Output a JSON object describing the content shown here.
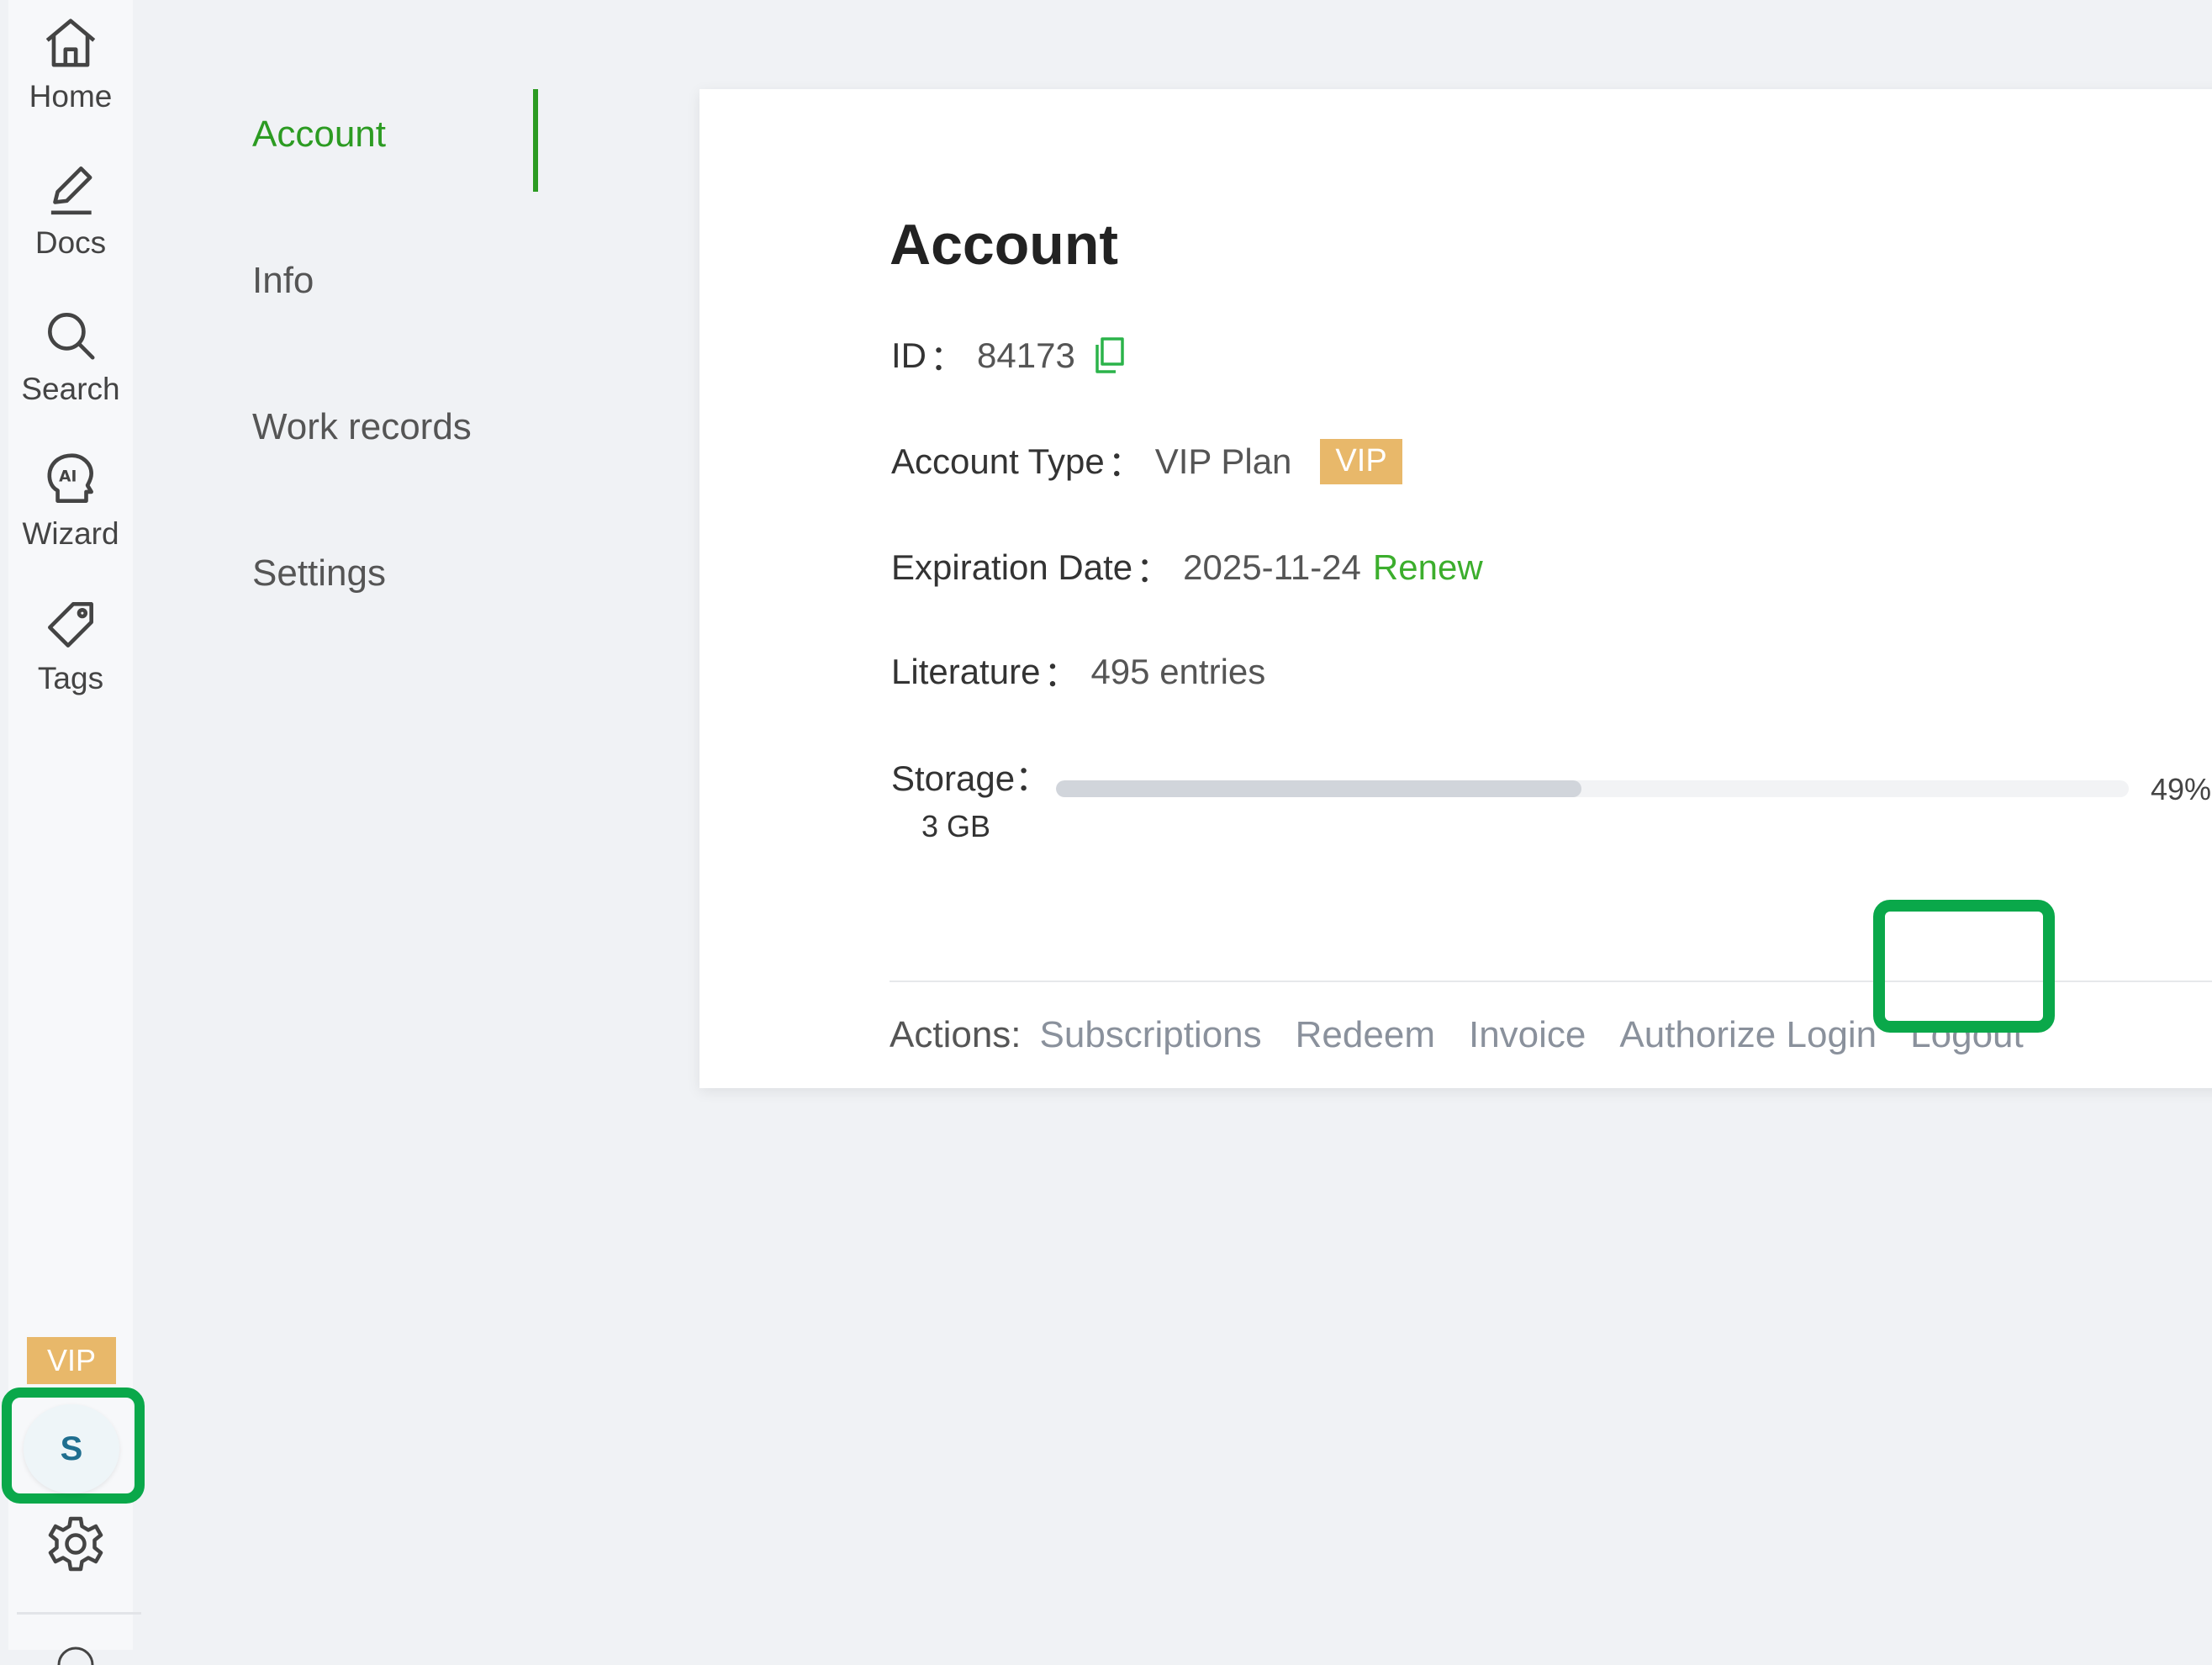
{
  "rail": {
    "items": [
      {
        "label": "Home",
        "icon": "home-icon"
      },
      {
        "label": "Docs",
        "icon": "pencil-icon"
      },
      {
        "label": "Search",
        "icon": "search-icon"
      },
      {
        "label": "Wizard",
        "icon": "ai-wizard-icon"
      },
      {
        "label": "Tags",
        "icon": "tag-icon"
      }
    ],
    "vip_badge": "VIP",
    "avatar_initial": "S"
  },
  "menu": {
    "items": [
      {
        "label": "Account",
        "active": true
      },
      {
        "label": "Info"
      },
      {
        "label": "Work records"
      },
      {
        "label": "Settings"
      }
    ]
  },
  "account": {
    "title": "Account",
    "id_label": "ID",
    "id_value": "84173",
    "type_label": "Account Type",
    "type_value": "VIP Plan",
    "type_badge": "VIP",
    "expiration_label": "Expiration Date",
    "expiration_value": "2025-11-24",
    "renew_label": "Renew",
    "literature_label": "Literature",
    "literature_value": "495 entries",
    "storage_label": "Storage",
    "storage_size": "3 GB",
    "storage_percent": 49,
    "storage_percent_text": "49%",
    "separator": "："
  },
  "actions": {
    "label": "Actions:",
    "items": [
      "Subscriptions",
      "Redeem",
      "Invoice",
      "Authorize Login",
      "Logout"
    ]
  },
  "colors": {
    "accent_green": "#2c9b22",
    "highlight_green": "#0aa84a",
    "vip_gold": "#e8b86a"
  }
}
